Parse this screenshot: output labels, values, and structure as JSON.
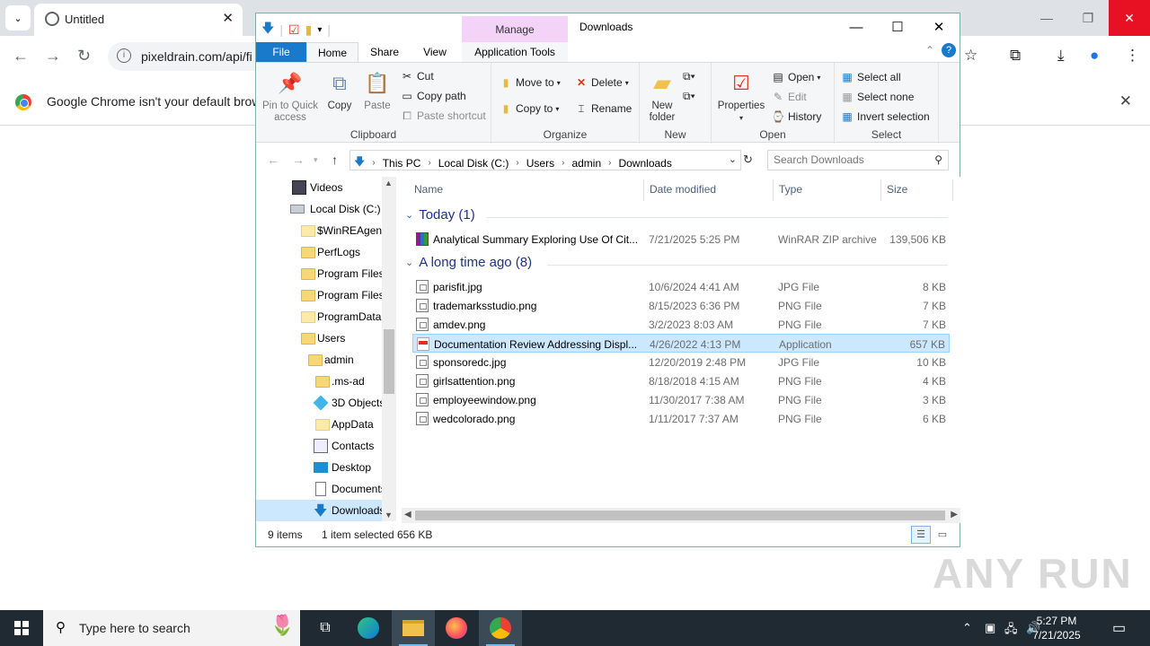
{
  "chrome": {
    "tab_title": "Untitled",
    "url": "pixeldrain.com/api/fi",
    "infobar_message": "Google Chrome isn't your default browse"
  },
  "explorer": {
    "window_title": "Downloads",
    "manage_label": "Manage",
    "ribbon_tabs": {
      "file": "File",
      "home": "Home",
      "share": "Share",
      "view": "View",
      "app_tools": "Application Tools"
    },
    "clipboard": {
      "pin": "Pin to Quick access",
      "copy": "Copy",
      "paste": "Paste",
      "cut": "Cut",
      "copy_path": "Copy path",
      "paste_shortcut": "Paste shortcut",
      "label": "Clipboard"
    },
    "organize": {
      "move_to": "Move to",
      "copy_to": "Copy to",
      "delete": "Delete",
      "rename": "Rename",
      "label": "Organize"
    },
    "new": {
      "new_folder": "New folder",
      "label": "New"
    },
    "open": {
      "properties": "Properties",
      "open": "Open",
      "edit": "Edit",
      "history": "History",
      "label": "Open"
    },
    "select": {
      "select_all": "Select all",
      "select_none": "Select none",
      "invert": "Invert selection",
      "label": "Select"
    },
    "breadcrumbs": [
      "This PC",
      "Local Disk (C:)",
      "Users",
      "admin",
      "Downloads"
    ],
    "search_placeholder": "Search Downloads",
    "nav_items": [
      {
        "label": "Videos"
      },
      {
        "label": "Local Disk (C:)"
      },
      {
        "label": "$WinREAgent"
      },
      {
        "label": "PerfLogs"
      },
      {
        "label": "Program Files"
      },
      {
        "label": "Program Files"
      },
      {
        "label": "ProgramData"
      },
      {
        "label": "Users"
      },
      {
        "label": "admin"
      },
      {
        "label": ".ms-ad"
      },
      {
        "label": "3D Objects"
      },
      {
        "label": "AppData"
      },
      {
        "label": "Contacts"
      },
      {
        "label": "Desktop"
      },
      {
        "label": "Documents"
      },
      {
        "label": "Downloads"
      }
    ],
    "columns": {
      "name": "Name",
      "date": "Date modified",
      "type": "Type",
      "size": "Size"
    },
    "groups": {
      "today": "Today (1)",
      "older": "A long time ago (8)"
    },
    "files_today": [
      {
        "name": "Analytical Summary Exploring Use Of Cit...",
        "date": "7/21/2025 5:25 PM",
        "type": "WinRAR ZIP archive",
        "size": "139,506 KB"
      }
    ],
    "files_older": [
      {
        "name": "parisfit.jpg",
        "date": "10/6/2024 4:41 AM",
        "type": "JPG File",
        "size": "8 KB"
      },
      {
        "name": "trademarksstudio.png",
        "date": "8/15/2023 6:36 PM",
        "type": "PNG File",
        "size": "7 KB"
      },
      {
        "name": "amdev.png",
        "date": "3/2/2023 8:03 AM",
        "type": "PNG File",
        "size": "7 KB"
      },
      {
        "name": "Documentation Review Addressing Displ...",
        "date": "4/26/2022 4:13 PM",
        "type": "Application",
        "size": "657 KB"
      },
      {
        "name": "sponsoredc.jpg",
        "date": "12/20/2019 2:48 PM",
        "type": "JPG File",
        "size": "10 KB"
      },
      {
        "name": "girlsattention.png",
        "date": "8/18/2018 4:15 AM",
        "type": "PNG File",
        "size": "4 KB"
      },
      {
        "name": "employeewindow.png",
        "date": "11/30/2017 7:38 AM",
        "type": "PNG File",
        "size": "3 KB"
      },
      {
        "name": "wedcolorado.png",
        "date": "1/11/2017 7:37 AM",
        "type": "PNG File",
        "size": "6 KB"
      }
    ],
    "status": {
      "count": "9 items",
      "selected": "1 item selected",
      "size": "656 KB"
    }
  },
  "watermark": "ANY RUN",
  "taskbar": {
    "search_text": "Type here to search",
    "time": "5:27 PM",
    "date": "7/21/2025"
  },
  "colors": {
    "accent": "#1979ca",
    "selection": "#cce8ff",
    "manage": "#f3d3f7",
    "taskbar": "#1f2a33"
  }
}
